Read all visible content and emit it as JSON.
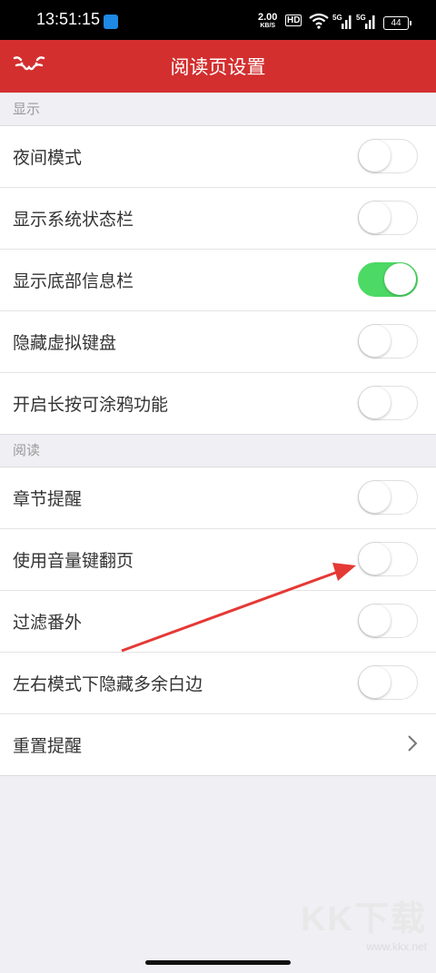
{
  "status_bar": {
    "time": "13:51:15",
    "net_speed": "2.00",
    "net_unit": "KB/S",
    "hd": "HD",
    "sig1": "5G",
    "sig2": "5G",
    "battery": "44"
  },
  "header": {
    "title": "阅读页设置",
    "back_icon": "cat-face-back-icon",
    "accent": "#d32f2f"
  },
  "sections": {
    "display": {
      "header": "显示",
      "items": [
        {
          "label": "夜间模式",
          "on": false
        },
        {
          "label": "显示系统状态栏",
          "on": false
        },
        {
          "label": "显示底部信息栏",
          "on": true
        },
        {
          "label": "隐藏虚拟键盘",
          "on": false
        },
        {
          "label": "开启长按可涂鸦功能",
          "on": false
        }
      ]
    },
    "reading": {
      "header": "阅读",
      "items": [
        {
          "label": "章节提醒",
          "on": false
        },
        {
          "label": "使用音量键翻页",
          "on": false
        },
        {
          "label": "过滤番外",
          "on": false
        },
        {
          "label": "左右模式下隐藏多余白边",
          "on": false
        },
        {
          "label": "重置提醒",
          "chevron": true
        }
      ]
    }
  },
  "watermark": {
    "text": "KK下载",
    "url": "www.kkx.net"
  }
}
